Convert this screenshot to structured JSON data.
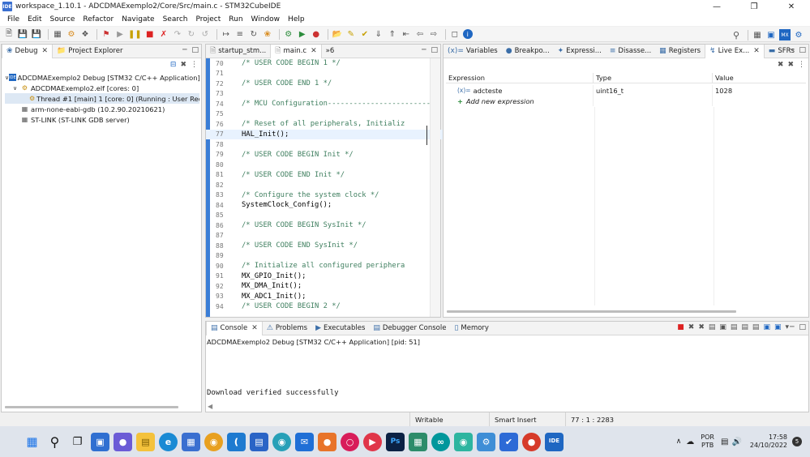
{
  "window": {
    "title": "workspace_1.10.1 - ADCDMAExemplo2/Core/Src/main.c - STM32CubeIDE",
    "app_badge": "IDE"
  },
  "menu": [
    "File",
    "Edit",
    "Source",
    "Refactor",
    "Navigate",
    "Search",
    "Project",
    "Run",
    "Window",
    "Help"
  ],
  "debug_panel": {
    "tabs": [
      {
        "label": "Debug"
      },
      {
        "label": "Project Explorer"
      }
    ],
    "tree": [
      {
        "label": "ADCDMAExemplo2 Debug [STM32 C/C++ Application]",
        "level": 0,
        "expanded": true,
        "icon": "launch-config-icon"
      },
      {
        "label": "ADCDMAExemplo2.elf [cores: 0]",
        "level": 1,
        "expanded": true,
        "icon": "process-icon"
      },
      {
        "label": "Thread #1 [main] 1 [core: 0] (Running : User Reque",
        "level": 2,
        "selected": true,
        "icon": "thread-icon"
      },
      {
        "label": "arm-none-eabi-gdb (10.2.90.20210621)",
        "level": 1,
        "icon": "gdb-icon"
      },
      {
        "label": "ST-LINK (ST-LINK GDB server)",
        "level": 1,
        "icon": "stlink-icon"
      }
    ]
  },
  "editor": {
    "tabs": [
      {
        "label": "startup_stm..."
      },
      {
        "label": "main.c",
        "active": true
      },
      {
        "label": "»6"
      }
    ],
    "current_line": "77",
    "lines": [
      {
        "n": "70",
        "t": "/* USER CODE BEGIN 1 */",
        "k": "cmt"
      },
      {
        "n": "71",
        "t": "",
        "k": "code"
      },
      {
        "n": "72",
        "t": "/* USER CODE END 1 */",
        "k": "cmt"
      },
      {
        "n": "73",
        "t": "",
        "k": "code"
      },
      {
        "n": "74",
        "t": "/* MCU Configuration--------------------------",
        "k": "cmt"
      },
      {
        "n": "75",
        "t": "",
        "k": "code"
      },
      {
        "n": "76",
        "t": "/* Reset of all peripherals, Initializ",
        "k": "cmt"
      },
      {
        "n": "77",
        "t": "HAL_Init();",
        "k": "code"
      },
      {
        "n": "78",
        "t": "",
        "k": "code"
      },
      {
        "n": "79",
        "t": "/* USER CODE BEGIN Init */",
        "k": "cmt"
      },
      {
        "n": "80",
        "t": "",
        "k": "code"
      },
      {
        "n": "81",
        "t": "/* USER CODE END Init */",
        "k": "cmt"
      },
      {
        "n": "82",
        "t": "",
        "k": "code"
      },
      {
        "n": "83",
        "t": "/* Configure the system clock */",
        "k": "cmt"
      },
      {
        "n": "84",
        "t": "SystemClock_Config();",
        "k": "code"
      },
      {
        "n": "85",
        "t": "",
        "k": "code"
      },
      {
        "n": "86",
        "t": "/* USER CODE BEGIN SysInit */",
        "k": "cmt"
      },
      {
        "n": "87",
        "t": "",
        "k": "code"
      },
      {
        "n": "88",
        "t": "/* USER CODE END SysInit */",
        "k": "cmt"
      },
      {
        "n": "89",
        "t": "",
        "k": "code"
      },
      {
        "n": "90",
        "t": "/* Initialize all configured periphera",
        "k": "cmt"
      },
      {
        "n": "91",
        "t": "MX_GPIO_Init();",
        "k": "code"
      },
      {
        "n": "92",
        "t": "MX_DMA_Init();",
        "k": "code"
      },
      {
        "n": "93",
        "t": "MX_ADC1_Init();",
        "k": "code"
      },
      {
        "n": "94",
        "t": "/* USER CODE BEGIN 2 */",
        "k": "cmt"
      }
    ]
  },
  "expressions_panel": {
    "tabs": [
      {
        "label": "Variables",
        "icon": "(x)="
      },
      {
        "label": "Breakpo...",
        "icon": "●"
      },
      {
        "label": "Expressi...",
        "icon": "✦"
      },
      {
        "label": "Disasse...",
        "icon": "≡"
      },
      {
        "label": "Registers",
        "icon": "▦"
      },
      {
        "label": "Live Ex...",
        "icon": "↯",
        "active": true
      },
      {
        "label": "SFRs",
        "icon": "▬"
      }
    ],
    "columns": [
      "Expression",
      "Type",
      "Value"
    ],
    "rows": [
      {
        "expression": "adcteste",
        "type": "uint16_t",
        "value": "1028"
      }
    ],
    "add_label": "Add new expression"
  },
  "console_panel": {
    "tabs": [
      {
        "label": "Console",
        "active": true
      },
      {
        "label": "Problems"
      },
      {
        "label": "Executables"
      },
      {
        "label": "Debugger Console"
      },
      {
        "label": "Memory"
      }
    ],
    "header": "ADCDMAExemplo2 Debug [STM32 C/C++ Application]  [pid: 51]",
    "output": "Download verified successfully"
  },
  "status": {
    "mode": "Writable",
    "insert": "Smart Insert",
    "position": "77 : 1 : 2283"
  },
  "taskbar": {
    "lang_top": "POR",
    "lang_bottom": "PTB",
    "time": "17:58",
    "date": "24/10/2022",
    "notif_count": "5",
    "ide_label": "IDE",
    "ps_label": "Ps"
  },
  "colors": {
    "accent": "#3a7dd6",
    "comment": "#3f7f5f",
    "selection": "#dde8f4",
    "current_line": "#e8f2fe"
  }
}
